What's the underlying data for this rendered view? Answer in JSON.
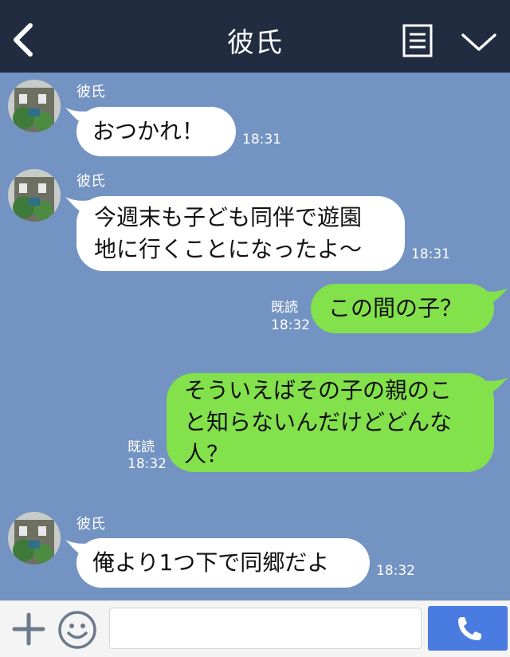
{
  "header": {
    "title": "彼氏"
  },
  "messages": [
    {
      "side": "left",
      "sender": "彼氏",
      "lines": [
        "おつかれ！"
      ],
      "time": "18:31"
    },
    {
      "side": "left",
      "sender": "彼氏",
      "lines": [
        "今週末も子ども同伴で遊園",
        "地に行くことになったよ～"
      ],
      "time": "18:31"
    },
    {
      "side": "right",
      "lines": [
        "この間の子？"
      ],
      "read": "既読",
      "time": "18:32"
    },
    {
      "side": "right",
      "lines": [
        "そういえばその子の親のこ",
        "と知らないんだけどどんな",
        "人？"
      ],
      "read": "既読",
      "time": "18:32"
    },
    {
      "side": "left",
      "sender": "彼氏",
      "lines": [
        "俺より1つ下で同郷だよ"
      ],
      "time": "18:32"
    }
  ],
  "footer": {
    "input_placeholder": ""
  },
  "colors": {
    "header_bg": "#222c40",
    "chat_bg": "#7393c2",
    "sent_bubble": "#83e14b",
    "received_bubble": "#ffffff",
    "call_button": "#4a7be0"
  },
  "icons": {
    "back": "chevron-left-icon",
    "menu": "list-icon",
    "collapse": "chevron-down-icon",
    "plus": "plus-icon",
    "emoji": "smiley-icon",
    "call": "phone-icon"
  }
}
